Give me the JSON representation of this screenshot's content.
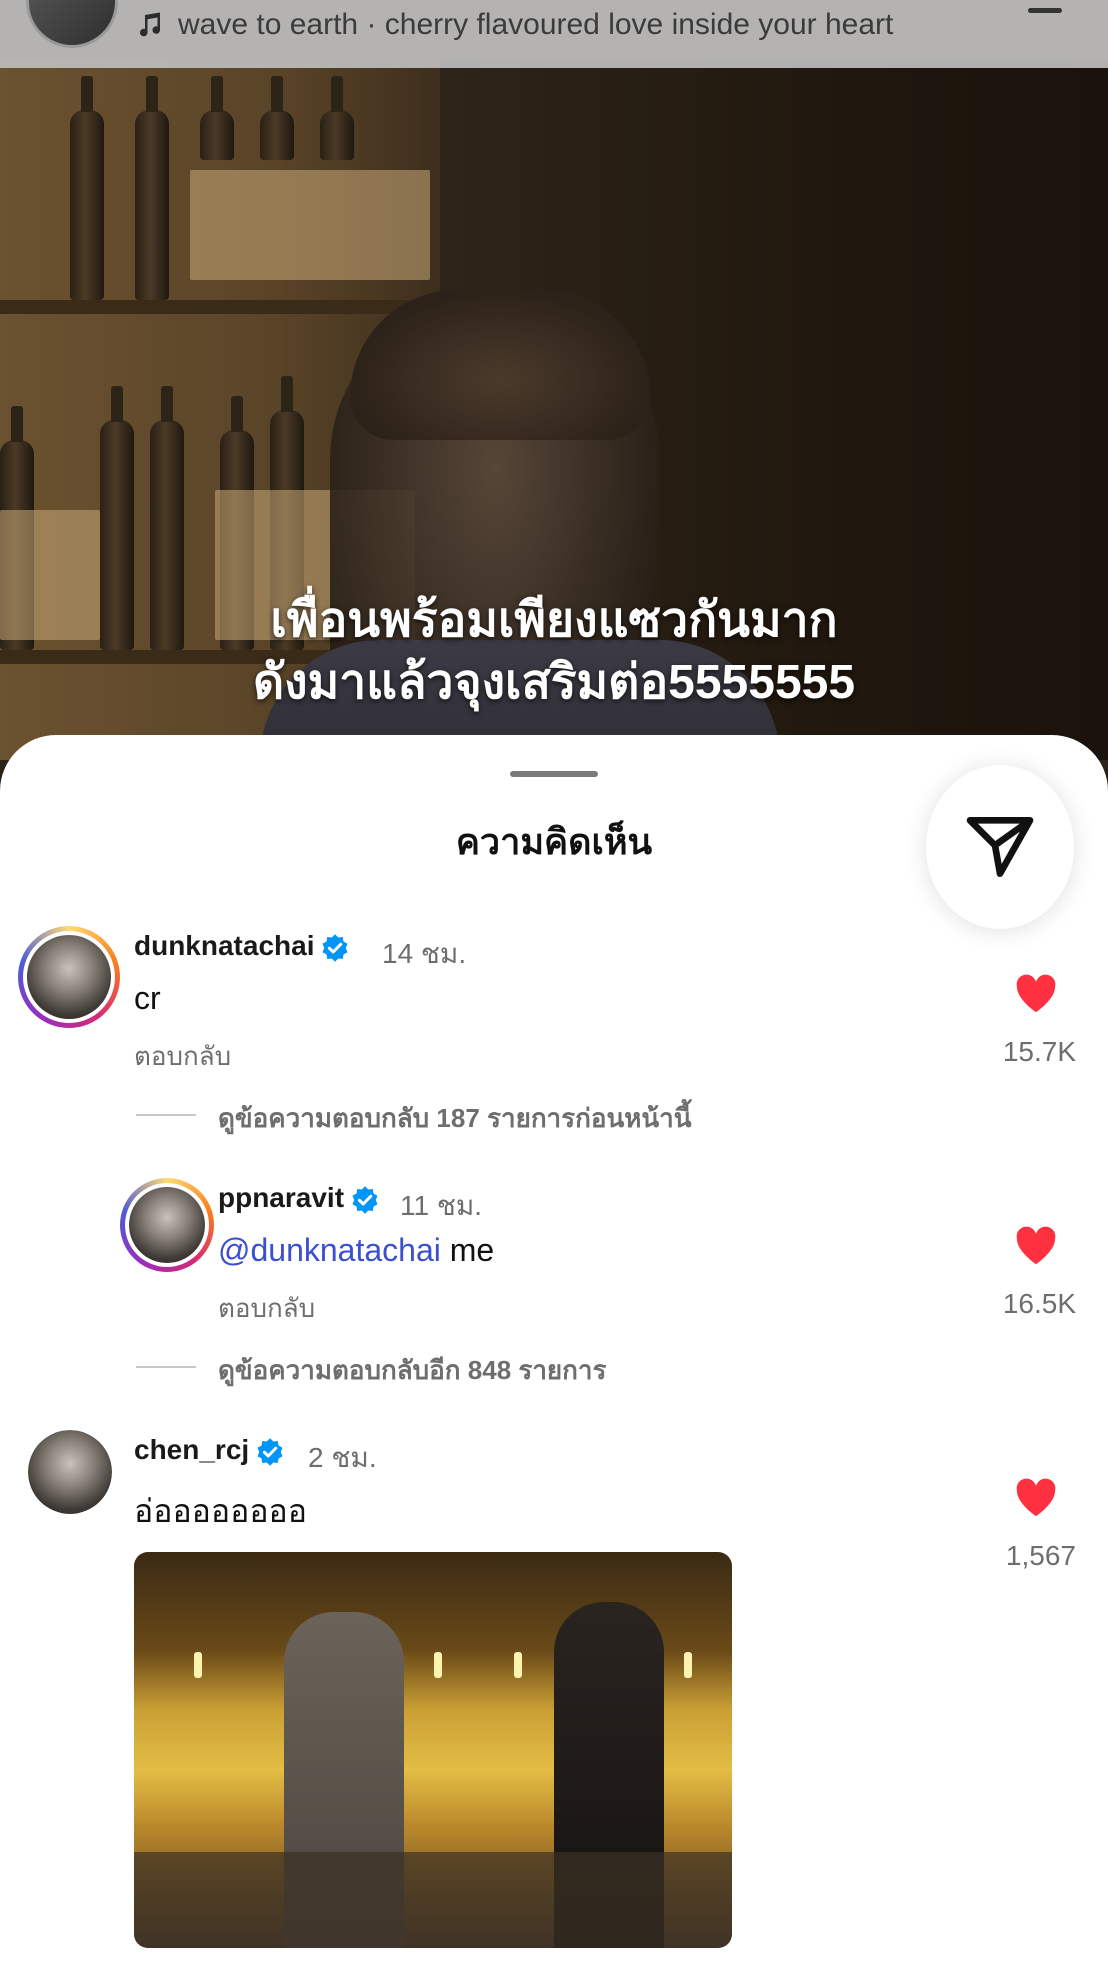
{
  "now_playing": {
    "artist_track": "wave to earth · cherry flavoured love inside your heart",
    "icon": "music-note-icon"
  },
  "video": {
    "caption_line1": "เพื่อนพร้อมเพียงแซวกันมาก",
    "caption_line2": "ดังมาแล้วจุงเสริมต่อ5555555"
  },
  "sheet": {
    "title": "ความคิดเห็น",
    "share_icon": "send-icon"
  },
  "comments": [
    {
      "username": "dunknatachai",
      "verified": true,
      "time": "14 ชม.",
      "text": "cr",
      "reply_label": "ตอบกลับ",
      "likes": "15.7K",
      "view_replies": "ดูข้อความตอบกลับ 187 รายการก่อนหน้านี้"
    },
    {
      "username": "ppnaravit",
      "verified": true,
      "time": "11 ชม.",
      "mention": "@dunknatachai",
      "text": " me",
      "reply_label": "ตอบกลับ",
      "likes": "16.5K",
      "view_replies": "ดูข้อความตอบกลับอีก 848 รายการ"
    },
    {
      "username": "chen_rcj",
      "verified": true,
      "time": "2 ชม.",
      "text": "อ่ออออออออ",
      "likes": "1,567"
    }
  ],
  "colors": {
    "heart": "#ff3040",
    "verified": "#0095f6",
    "mention": "#3b4fd1"
  }
}
